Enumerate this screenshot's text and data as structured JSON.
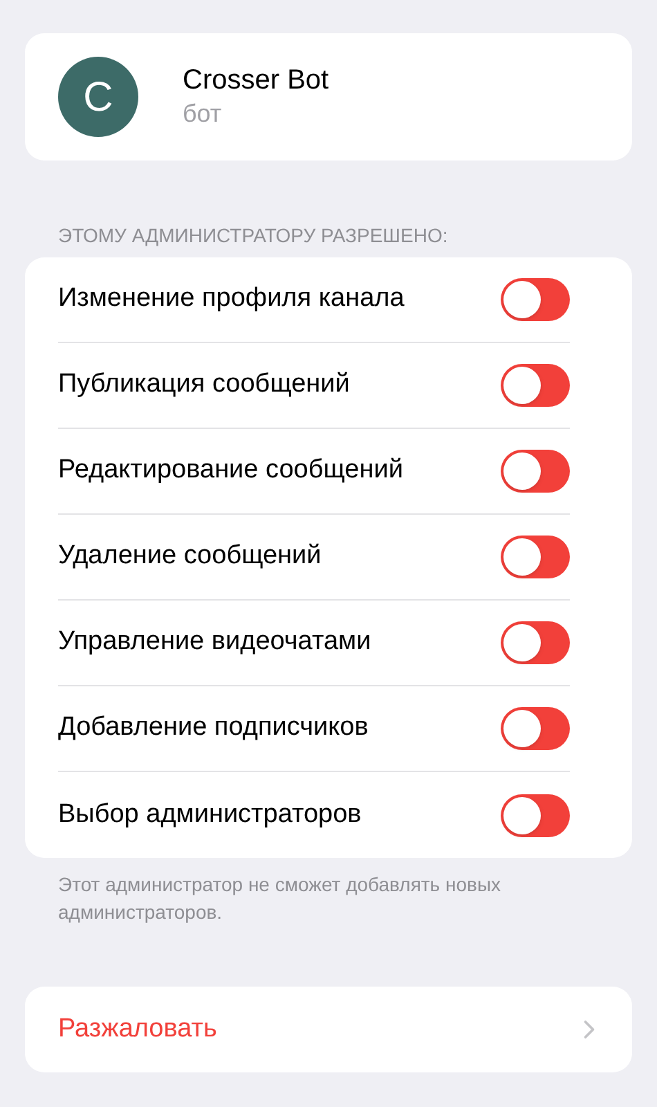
{
  "profile": {
    "initial": "C",
    "name": "Crosser Bot",
    "subtitle": "бот"
  },
  "section_header": "ЭТОМУ АДМИНИСТРАТОРУ РАЗРЕШЕНО:",
  "permissions": [
    {
      "label": "Изменение профиля канала",
      "on": false
    },
    {
      "label": "Публикация сообщений",
      "on": false
    },
    {
      "label": "Редактирование сообщений",
      "on": false
    },
    {
      "label": "Удаление сообщений",
      "on": false
    },
    {
      "label": "Управление видеочатами",
      "on": false
    },
    {
      "label": "Добавление подписчиков",
      "on": false
    },
    {
      "label": "Выбор администраторов",
      "on": false
    }
  ],
  "section_footer": "Этот администратор не сможет добавлять новых администраторов.",
  "dismiss": {
    "label": "Разжаловать"
  }
}
